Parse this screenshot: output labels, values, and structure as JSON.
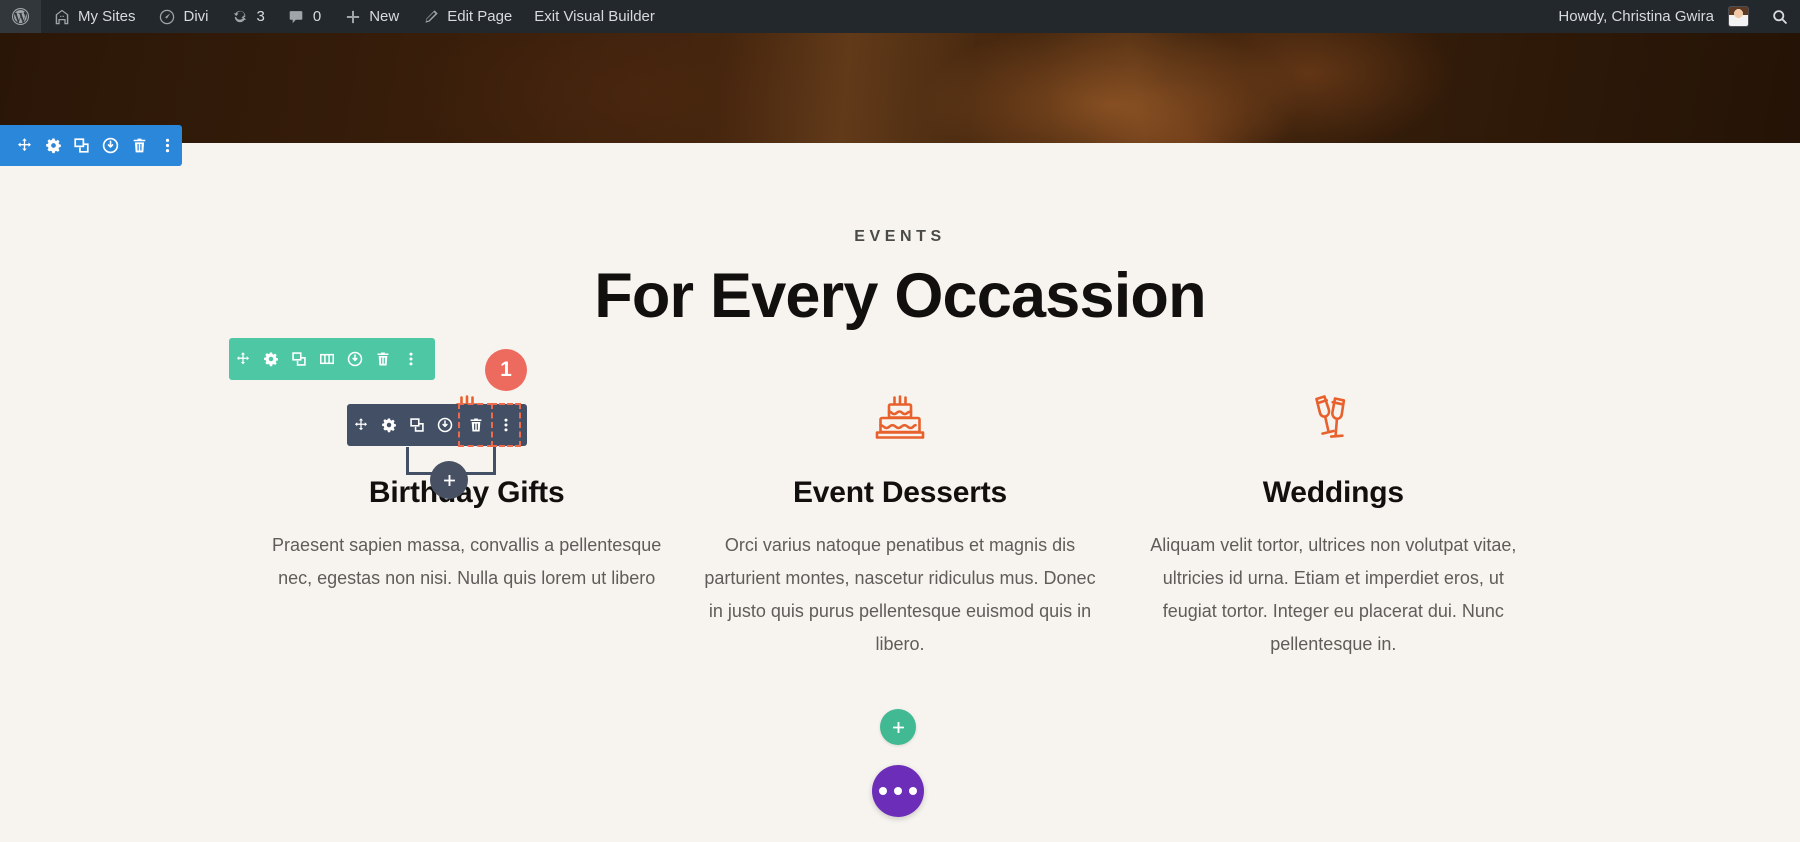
{
  "admin_bar": {
    "items": [
      {
        "label": "",
        "icon": "wordpress-logo-icon"
      },
      {
        "label": "My Sites",
        "icon": "sites-icon"
      },
      {
        "label": "Divi",
        "icon": "divi-dashboard-icon"
      },
      {
        "label": "3",
        "icon": "updates-icon"
      },
      {
        "label": "0",
        "icon": "comments-icon"
      },
      {
        "label": "New",
        "icon": "plus-icon"
      },
      {
        "label": "Edit Page",
        "icon": "pencil-icon"
      },
      {
        "label": "Exit Visual Builder",
        "icon": "none"
      }
    ],
    "howdy": "Howdy, Christina Gwira",
    "search_icon": "search-icon"
  },
  "page": {
    "eyebrow": "EVENTS",
    "title": "For Every Occassion",
    "columns": [
      {
        "icon": "birthday-cake-icon",
        "title": "Birthday Gifts",
        "body": "Praesent sapien massa, convallis a pellentesque nec, egestas non nisi. Nulla quis lorem ut libero"
      },
      {
        "icon": "birthday-cake-icon",
        "title": "Event Desserts",
        "body": "Orci varius natoque penatibus et magnis dis parturient montes, nascetur ridiculus mus. Donec in justo quis purus pellentesque euismod quis in libero."
      },
      {
        "icon": "champagne-glasses-icon",
        "title": "Weddings",
        "body": "Aliquam velit tortor, ultrices non volutpat vitae, ultricies id urna. Etiam et imperdiet eros, ut feugiat tortor. Integer eu placerat dui. Nunc pellentesque in."
      }
    ]
  },
  "builder": {
    "section_toolbar": {
      "color": "#2b87da",
      "buttons": [
        "move-section-icon",
        "section-settings-icon",
        "duplicate-section-icon",
        "disable-section-icon",
        "delete-section-icon",
        "section-options-icon"
      ]
    },
    "row_toolbar": {
      "color": "#4ec7a5",
      "badge": "1",
      "badge_color": "#ec6b5e",
      "buttons": [
        "move-row-icon",
        "row-settings-icon",
        "duplicate-row-icon",
        "column-structure-icon",
        "disable-row-icon",
        "delete-row-icon",
        "row-options-icon"
      ]
    },
    "module_toolbar": {
      "color": "#424f64",
      "highlight_color": "#ef6a4c",
      "buttons": [
        "move-module-icon",
        "module-settings-icon",
        "duplicate-module-icon",
        "disable-module-icon",
        "delete-module-icon",
        "module-options-icon"
      ],
      "highlighted_button": "delete-module-icon"
    },
    "module_add_label": "add-module-icon",
    "add_module_button": {
      "icon": "plus-icon",
      "color": "#41ba94"
    },
    "settings_fab": {
      "icon": "ellipsis-icon",
      "color": "#6c2eb9"
    }
  }
}
